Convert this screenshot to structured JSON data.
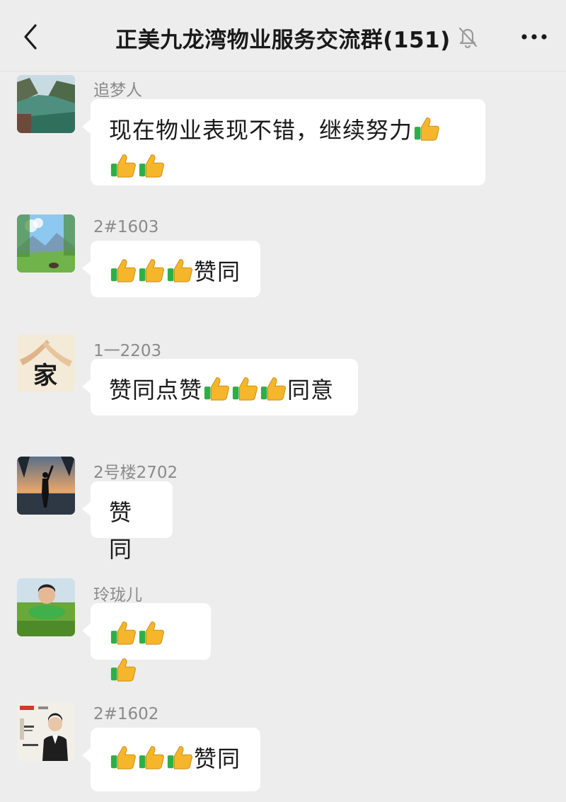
{
  "header": {
    "title": "正美九龙湾物业服务交流群(151)",
    "back_icon": "chevron-left-icon",
    "mute_icon": "bell-off-icon",
    "more_icon": "more-dots-icon"
  },
  "thumb_emoji": "👍",
  "messages": [
    {
      "nickname": "追梦人",
      "avatar": "landscape-river-avatar",
      "text": "现在物业表现不错，继续努力👍👍👍"
    },
    {
      "nickname": "2#1603",
      "avatar": "mountain-meadow-avatar",
      "text": "👍👍👍赞同"
    },
    {
      "nickname": "1一2203",
      "avatar": "family-character-avatar",
      "avatar_text": "家",
      "text": "赞同点赞👍👍👍同意"
    },
    {
      "nickname": "2号楼2702",
      "avatar": "sunset-silhouette-avatar",
      "text": "赞同"
    },
    {
      "nickname": "玲珑儿",
      "avatar": "child-on-grass-avatar",
      "text": "👍👍👍"
    },
    {
      "nickname": "2#1602",
      "avatar": "business-card-avatar",
      "text": "👍👍👍赞同"
    }
  ]
}
